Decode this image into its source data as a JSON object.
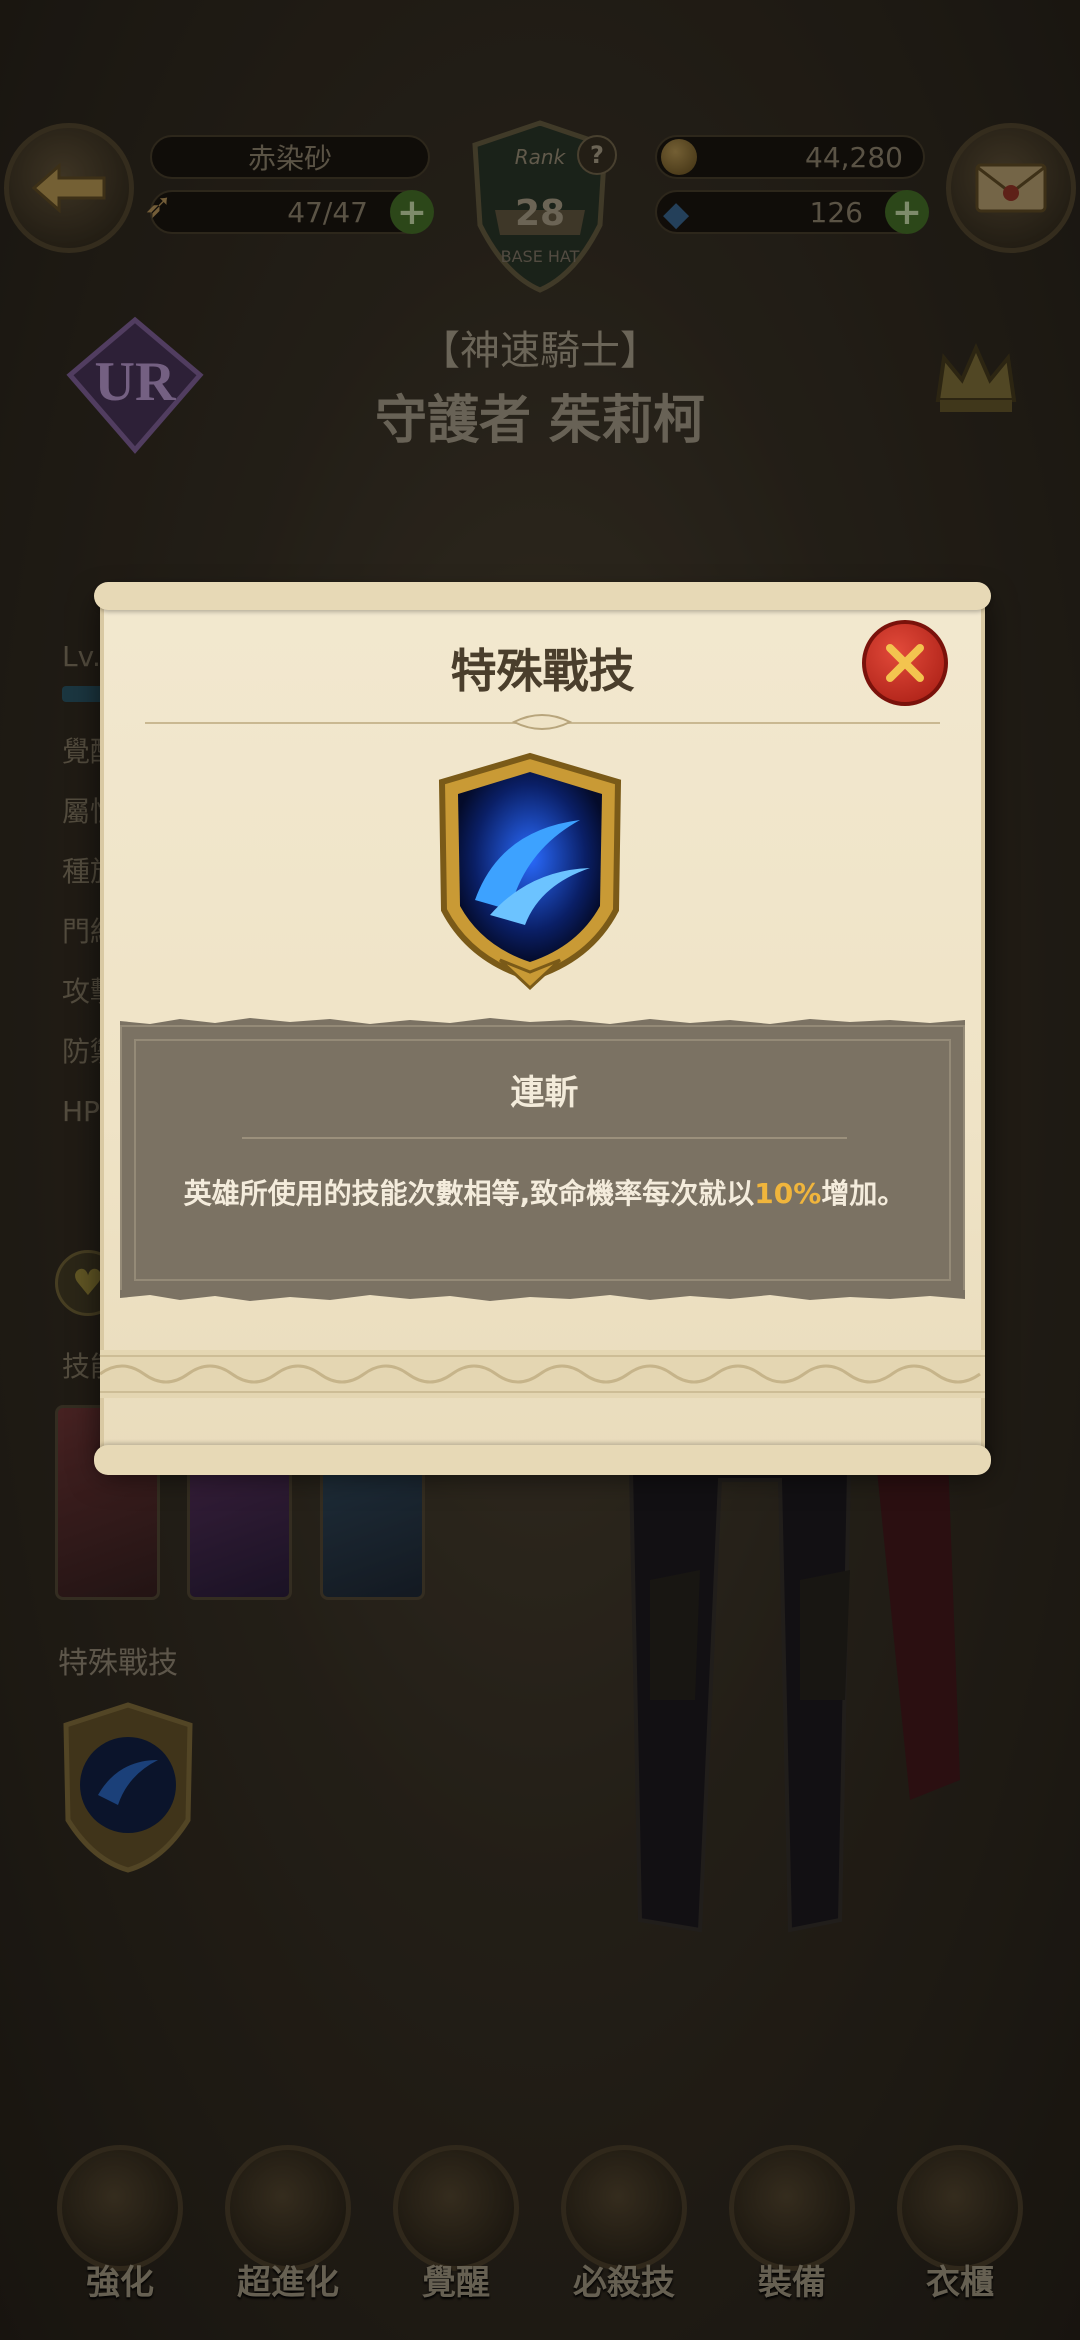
{
  "header": {
    "player_name": "赤染砂",
    "stamina": "47/47",
    "gold": "44,280",
    "gems": "126",
    "rank_label": "Rank",
    "rank_value": "28",
    "rank_sub": "BASE HAT"
  },
  "hero": {
    "rarity": "UR",
    "class_title": "【神速騎士】",
    "name": "守護者 茱莉柯"
  },
  "stats_labels": [
    "Lv.",
    "覺醒",
    "屬性",
    "種族",
    "門級",
    "攻擊",
    "防禦",
    "HP"
  ],
  "sections": {
    "skills_label": "技能",
    "special_label": "特殊戰技"
  },
  "modal": {
    "title": "特殊戰技",
    "skill_name": "連斬",
    "desc_before": "英雄所使用的技能次數相等,致命機率每次就以",
    "desc_highlight": "10%",
    "desc_after": "增加。"
  },
  "bottom_nav": [
    "強化",
    "超進化",
    "覺醒",
    "必殺技",
    "裝備",
    "衣櫃"
  ],
  "colors": {
    "accent_gold": "#f0b53c",
    "close_red": "#c72d1f",
    "skill_blue": "#1f7bff"
  }
}
